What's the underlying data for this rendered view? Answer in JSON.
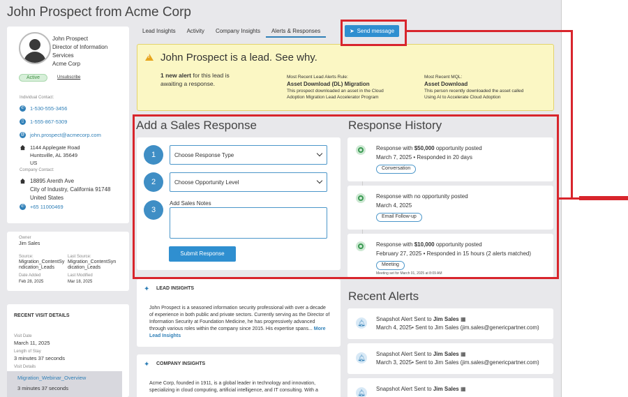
{
  "title": "John Prospect from Acme Corp",
  "contact": {
    "name_lines": [
      "John Prospect",
      "Director of Information Services",
      "Acme Corp"
    ],
    "status": "Active",
    "unsubscribe": "Unsubscribe",
    "individual_label": "Individual Contact:",
    "phone1": "1-530-555-3456",
    "phone2": "1-555-867-5309",
    "email": "john.prospect@acmecorp.com",
    "address_lines": [
      "1144 Applegate Road",
      "Huntsville, AL 35649",
      "US"
    ],
    "company_label": "Company Contact:",
    "company_address_lines": [
      "18895 Arenth Ave",
      "City of Industry, California 91748",
      "United States"
    ],
    "company_phone": "+65 11000469"
  },
  "meta": {
    "owner_label": "Owner",
    "owner": "Jim Sales",
    "source_label": "Source:",
    "source": "Migration_ContentSyndication_Leads",
    "last_source_label": "Last Source:",
    "last_source": "Migration_ContentSyndication_Leads",
    "date_added_label": "Date Added",
    "date_added": "Feb 28, 2025",
    "last_modified_label": "Last Modified",
    "last_modified": "Mar 18, 2025"
  },
  "visits": {
    "heading": "RECENT VISIT DETAILS",
    "visit_date_label": "Visit Date",
    "visit_date": "March 11, 2025",
    "length_label": "Length of Stay",
    "length": "3 minutes 37 seconds",
    "details_label": "Visit Details",
    "item_title": "Migration_Webinar_Overview",
    "item_duration": "3 minutes 37 seconds"
  },
  "tabs": [
    "Lead Insights",
    "Activity",
    "Company Insights",
    "Alerts & Responses"
  ],
  "send_button": "Send message",
  "banner": {
    "heading": "John Prospect is a lead. See why.",
    "alert_count": "1 new alert",
    "alert_rest": "for this lead is awaiting a response.",
    "rule_label": "Most Recent Lead Alerts Rule:",
    "rule_title": "Asset Download (DL) Migration",
    "rule_desc": "This prospect downloaded an asset in the Cloud Adoption Migration Lead Accelerator Program",
    "mql_label": "Most Recent MQL:",
    "mql_title": "Asset Download",
    "mql_desc": "This person recently downloaded the asset called Using AI to Accelerate Cloud Adoption"
  },
  "sales_response": {
    "heading": "Add a Sales Response",
    "step1": "1",
    "step2": "2",
    "step3": "3",
    "response_type_placeholder": "Choose Response Type",
    "opportunity_placeholder": "Choose Opportunity Level",
    "notes_label": "Add Sales Notes",
    "submit": "Submit Response"
  },
  "history": {
    "heading": "Response History",
    "items": [
      {
        "pre": "Response with ",
        "bold": "$50,000",
        "post": " opportunity posted",
        "line2": "March 7, 2025 • Responded in 20 days",
        "tag": "Conversation",
        "note": ""
      },
      {
        "pre": "Response with no opportunity posted",
        "bold": "",
        "post": "",
        "line2": "March 4, 2025",
        "tag": "Email Follow-up",
        "note": ""
      },
      {
        "pre": "Response with ",
        "bold": "$10,000",
        "post": " opportunity posted",
        "line2": "February 27, 2025 • Responded in 15 hours (2 alerts matched)",
        "tag": "Meeting",
        "note": "Meeting set for March 01, 2025 at 8:09 AM"
      }
    ]
  },
  "lead_insights": {
    "heading": "LEAD INSIGHTS",
    "text": "John Prospect is a seasoned information security professional with over a decade of experience in both public and private sectors. Currently serving as the Director of Information Security at Foundation Medicine, he has progressively advanced through various roles within the company since 2015. His expertise spans...",
    "more": "More Lead Insights"
  },
  "company_insights": {
    "heading": "COMPANY INSIGHTS",
    "text": "Acme Corp, founded in 1911, is a global leader in technology and innovation, specializing in cloud computing, artificial intelligence, and IT consulting. With a"
  },
  "recent_alerts": {
    "heading": "Recent Alerts",
    "items": [
      {
        "pre": "Snapshot Alert Sent to ",
        "bold": "Jim Sales",
        "line2": "March 4, 2025• Sent to Jim Sales (jim.sales@genericpartner.com)"
      },
      {
        "pre": "Snapshot Alert Sent to ",
        "bold": "Jim Sales",
        "line2": "March 3, 2025• Sent to Jim Sales (jim.sales@genericpartner.com)"
      },
      {
        "pre": "Snapshot Alert Sent to ",
        "bold": "Jim Sales",
        "line2": ""
      }
    ]
  },
  "colors": {
    "accent": "#2f8fd0",
    "highlight": "#d8252c",
    "banner": "#fbf7c4"
  }
}
